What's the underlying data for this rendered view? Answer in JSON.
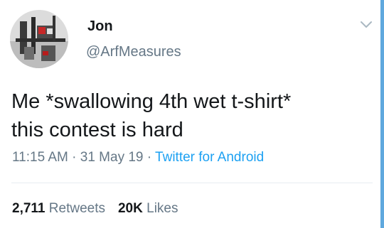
{
  "tweet": {
    "author": {
      "display_name": "Jon",
      "handle": "@ArfMeasures",
      "avatar_icon": "avatar-image"
    },
    "menu_icon": "chevron-down-icon",
    "text_lines": [
      "Me *swallowing 4th wet t-shirt*",
      "this contest is hard"
    ],
    "time": "11:15 AM",
    "separator": "·",
    "date": "31 May 19",
    "source": "Twitter for Android",
    "retweets": {
      "count": "2,711",
      "label": "Retweets"
    },
    "likes": {
      "count": "20K",
      "label": "Likes"
    }
  },
  "colors": {
    "primary_text": "#14171a",
    "secondary_text": "#657786",
    "link": "#1da1f2",
    "divider": "#e6ecf0",
    "scrollbar": "#5fa8de"
  }
}
